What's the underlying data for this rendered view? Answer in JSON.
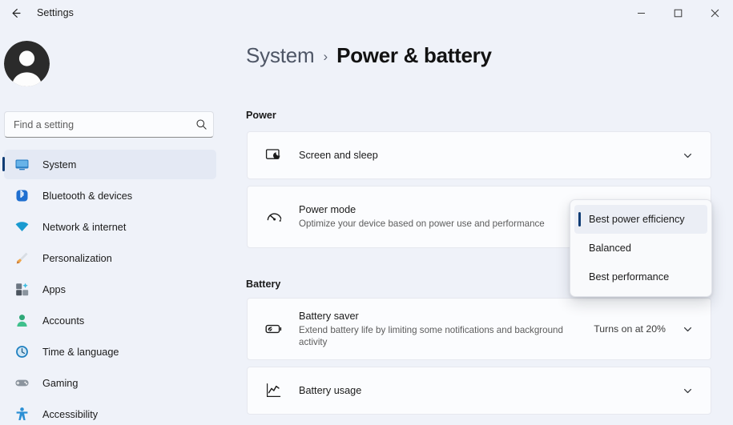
{
  "titlebar": {
    "back_label": "back-arrow",
    "app_title": "Settings",
    "minimize": "—",
    "maximize": "☐",
    "close": "✕"
  },
  "sidebar": {
    "search": {
      "placeholder": "Find a setting",
      "value": "",
      "icon": "search-icon"
    },
    "items": [
      {
        "label": "System",
        "icon": "monitor-icon",
        "selected": true
      },
      {
        "label": "Bluetooth & devices",
        "icon": "bluetooth-icon",
        "selected": false
      },
      {
        "label": "Network & internet",
        "icon": "wifi-icon",
        "selected": false
      },
      {
        "label": "Personalization",
        "icon": "paintbrush-icon",
        "selected": false
      },
      {
        "label": "Apps",
        "icon": "apps-icon",
        "selected": false
      },
      {
        "label": "Accounts",
        "icon": "person-icon",
        "selected": false
      },
      {
        "label": "Time & language",
        "icon": "clock-icon",
        "selected": false
      },
      {
        "label": "Gaming",
        "icon": "gamepad-icon",
        "selected": false
      },
      {
        "label": "Accessibility",
        "icon": "accessibility-icon",
        "selected": false
      }
    ]
  },
  "header": {
    "breadcrumb_parent": "System",
    "breadcrumb_separator": "›",
    "breadcrumb_current": "Power & battery"
  },
  "main": {
    "sections": {
      "power": "Power",
      "battery": "Battery"
    },
    "cards": {
      "screen_and_sleep": {
        "title": "Screen and sleep",
        "icon": "monitor-moon-icon",
        "chevron": "chevron-down-icon"
      },
      "power_mode": {
        "title": "Power mode",
        "description": "Optimize your device based on power use and performance",
        "icon": "gauge-icon"
      },
      "battery_saver": {
        "title": "Battery saver",
        "description": "Extend battery life by limiting some notifications and background activity",
        "value": "Turns on at 20%",
        "icon": "battery-leaf-icon",
        "chevron": "chevron-down-icon"
      },
      "battery_usage": {
        "title": "Battery usage",
        "icon": "line-chart-icon",
        "chevron": "chevron-down-icon"
      }
    }
  },
  "dropdown": {
    "open": true,
    "selected_index": 0,
    "options": [
      {
        "label": "Best power efficiency"
      },
      {
        "label": "Balanced"
      },
      {
        "label": "Best performance"
      }
    ]
  },
  "colors": {
    "accent": "#0f3c75",
    "page_background": "#eff2f9",
    "card_background": "#fbfcfe",
    "text_primary": "#1b1b1b",
    "text_secondary": "#5c5c5c"
  }
}
